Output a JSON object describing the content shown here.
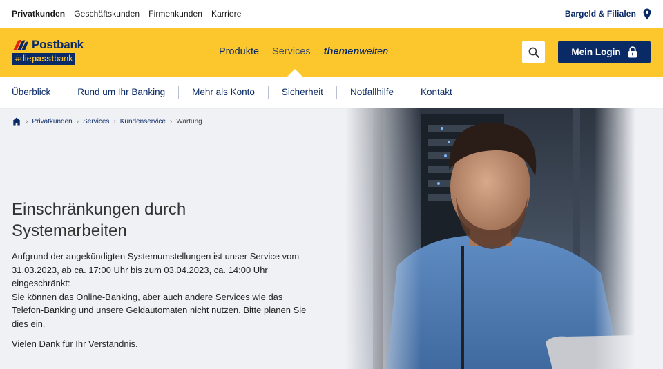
{
  "topbar": {
    "links": [
      "Privatkunden",
      "Geschäftskunden",
      "Firmenkunden",
      "Karriere"
    ],
    "branches_link": "Bargeld & Filialen"
  },
  "brand": {
    "name": "Postbank",
    "tag_prefix": "#die",
    "tag_bold": "passt",
    "tag_suffix": "bank",
    "colors": {
      "yellow": "#fcc72c",
      "navy": "#0a2a66",
      "red": "#e2231a"
    }
  },
  "mainnav": {
    "items": [
      "Produkte",
      "Services"
    ],
    "themen_a": "themen",
    "themen_b": "welten"
  },
  "header": {
    "search_icon": "search-icon",
    "login_label": "Mein Login",
    "login_icon": "lock-icon"
  },
  "subnav": {
    "items": [
      "Überblick",
      "Rund um Ihr Banking",
      "Mehr als Konto",
      "Sicherheit",
      "Notfallhilfe",
      "Kontakt"
    ]
  },
  "breadcrumb": {
    "home_icon": "home-icon",
    "items": [
      "Privatkunden",
      "Services",
      "Kundenservice"
    ],
    "current": "Wartung"
  },
  "content": {
    "headline_line1": "Einschränkungen durch",
    "headline_line2": "Systemarbeiten",
    "para1_line1": "Aufgrund der angekündigten Systemumstellungen ist unser Service vom",
    "para1_line2": "31.03.2023, ab ca. 17:00 Uhr bis zum 03.04.2023, ca. 14:00 Uhr",
    "para1_line3": "eingeschränkt:",
    "para2_line1": "Sie können das Online-Banking, aber auch andere Services wie das",
    "para2_line2": "Telefon-Banking und unsere Geldautomaten nicht nutzen. Bitte planen Sie",
    "para2_line3": "dies ein.",
    "thanks": "Vielen Dank für Ihr Verständnis."
  }
}
